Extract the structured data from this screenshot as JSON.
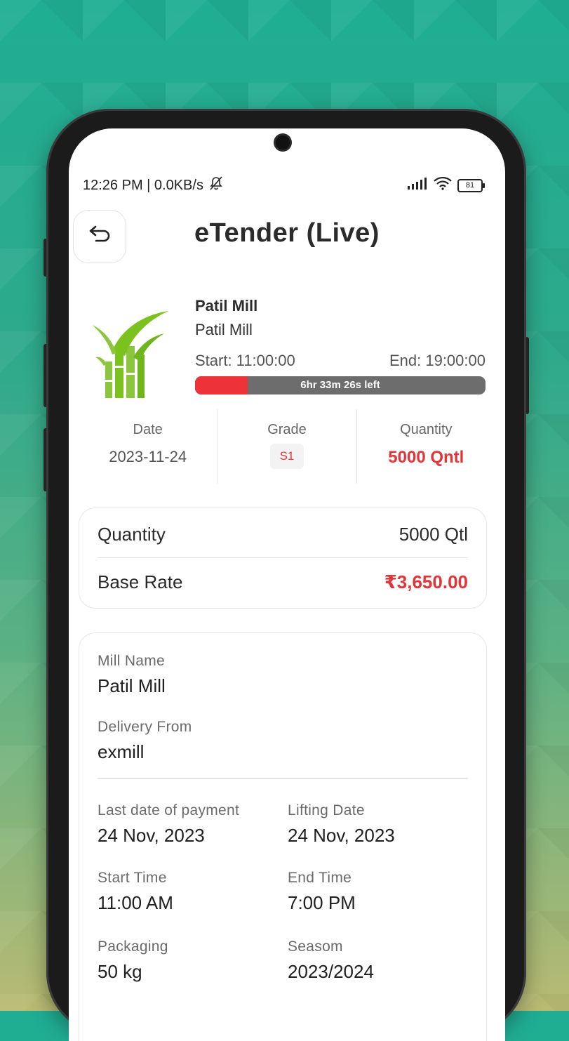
{
  "status_bar": {
    "time": "12:26 PM | 0.0KB/s",
    "battery": "81"
  },
  "header": {
    "title": "eTender (Live)"
  },
  "tender": {
    "mill_title": "Patil Mill",
    "mill_subtitle": "Patil Mill",
    "start": "Start: 11:00:00",
    "end": "End: 19:00:00",
    "progress_text": "6hr 33m 26s left",
    "progress_elapsed_fraction": 0.18
  },
  "stats": {
    "date_label": "Date",
    "date_value": "2023-11-24",
    "grade_label": "Grade",
    "grade_value": "S1",
    "qty_label": "Quantity",
    "qty_value": "5000 Qntl"
  },
  "rates": {
    "quantity_label": "Quantity",
    "quantity_value": "5000 Qtl",
    "base_rate_label": "Base Rate",
    "base_rate_value": "₹3,650.00"
  },
  "details": {
    "mill_name_label": "Mill Name",
    "mill_name_value": "Patil Mill",
    "delivery_label": "Delivery From",
    "delivery_value": "exmill",
    "last_payment_label": "Last date of payment",
    "last_payment_value": "24 Nov, 2023",
    "lifting_label": "Lifting Date",
    "lifting_value": "24 Nov, 2023",
    "start_time_label": "Start Time",
    "start_time_value": "11:00 AM",
    "end_time_label": "End Time",
    "end_time_value": "7:00 PM",
    "packaging_label": "Packaging",
    "packaging_value": "50 kg",
    "season_label": "Seasom",
    "season_value": "2023/2024"
  },
  "colors": {
    "accent_red": "#e3343a",
    "progress_track": "#6d6d6d",
    "logo_green": "#7cc21f"
  }
}
